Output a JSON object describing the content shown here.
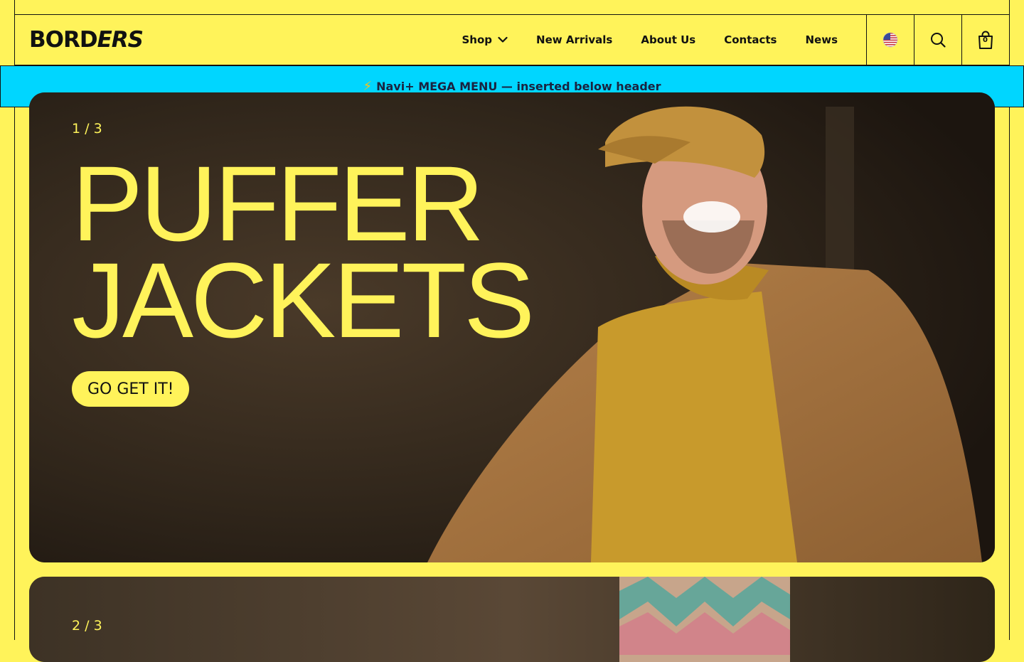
{
  "header": {
    "logo_part1": "BORD",
    "logo_part2": "ERS",
    "nav": {
      "shop": "Shop",
      "new_arrivals": "New Arrivals",
      "about": "About Us",
      "contacts": "Contacts",
      "news": "News"
    },
    "cart_count": "0",
    "icons": {
      "flag": "us-flag-icon",
      "search": "search-icon",
      "cart": "shopping-bag-icon",
      "dropdown": "chevron-down-icon"
    }
  },
  "banner": {
    "icon": "⚡",
    "text": "Navi+ MEGA MENU — inserted below header"
  },
  "slides": [
    {
      "counter": "1 / 3",
      "headline_line1": "PUFFER",
      "headline_line2": "JACKETS",
      "cta": "GO GET IT!"
    },
    {
      "counter": "2 / 3"
    }
  ],
  "colors": {
    "brand_yellow": "#fff35a",
    "banner_cyan": "#00d6ff",
    "ink": "#111111"
  }
}
